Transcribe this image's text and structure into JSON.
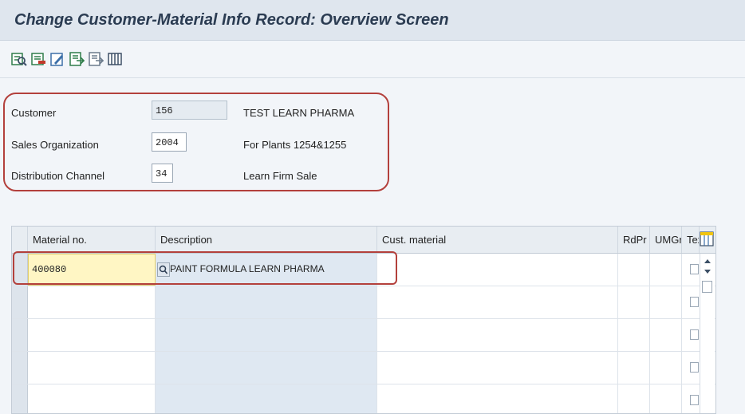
{
  "window": {
    "title": "Change Customer-Material Info Record: Overview Screen"
  },
  "toolbar": {
    "icons": [
      "details-icon",
      "delete-row-icon",
      "edit-icon",
      "select-all-icon",
      "deselect-icon",
      "column-settings-icon"
    ]
  },
  "header_fields": [
    {
      "label": "Customer",
      "value": "156",
      "description": "TEST LEARN PHARMA"
    },
    {
      "label": "Sales Organization",
      "value": "2004",
      "description": "For Plants 1254&1255"
    },
    {
      "label": "Distribution Channel",
      "value": "34",
      "description": "Learn Firm Sale"
    }
  ],
  "table": {
    "columns": [
      "Material no.",
      "Description",
      "Cust. material",
      "RdPr",
      "UMGr",
      "Tex"
    ],
    "rows": [
      {
        "material_no": "400080",
        "description": "PAINT FORMULA LEARN PHARMA",
        "cust_material": "",
        "rdpr": "",
        "umgr": ""
      },
      {
        "material_no": "",
        "description": "",
        "cust_material": "",
        "rdpr": "",
        "umgr": ""
      },
      {
        "material_no": "",
        "description": "",
        "cust_material": "",
        "rdpr": "",
        "umgr": ""
      },
      {
        "material_no": "",
        "description": "",
        "cust_material": "",
        "rdpr": "",
        "umgr": ""
      },
      {
        "material_no": "",
        "description": "",
        "cust_material": "",
        "rdpr": "",
        "umgr": ""
      }
    ]
  },
  "colors": {
    "highlight": "#b3403c",
    "title": "#2b3c52",
    "input_focus": "#fff6c4"
  }
}
